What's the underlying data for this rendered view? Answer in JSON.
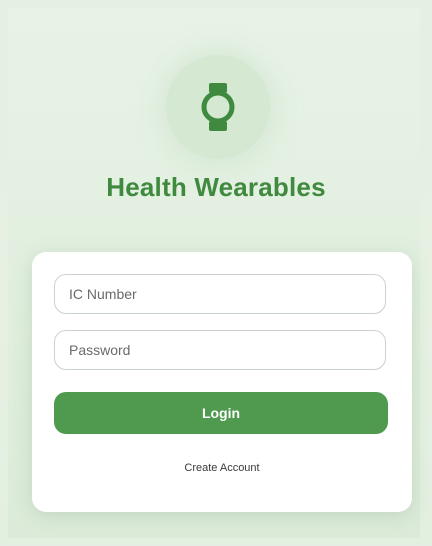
{
  "app": {
    "title": "Health Wearables",
    "logo_icon": "smartwatch-icon",
    "brand_color": "#4f9a4f",
    "title_color": "#3f8a3f"
  },
  "login_form": {
    "ic_number": {
      "placeholder": "IC Number",
      "value": ""
    },
    "password": {
      "placeholder": "Password",
      "value": ""
    },
    "login_label": "Login",
    "create_account_label": "Create Account"
  }
}
